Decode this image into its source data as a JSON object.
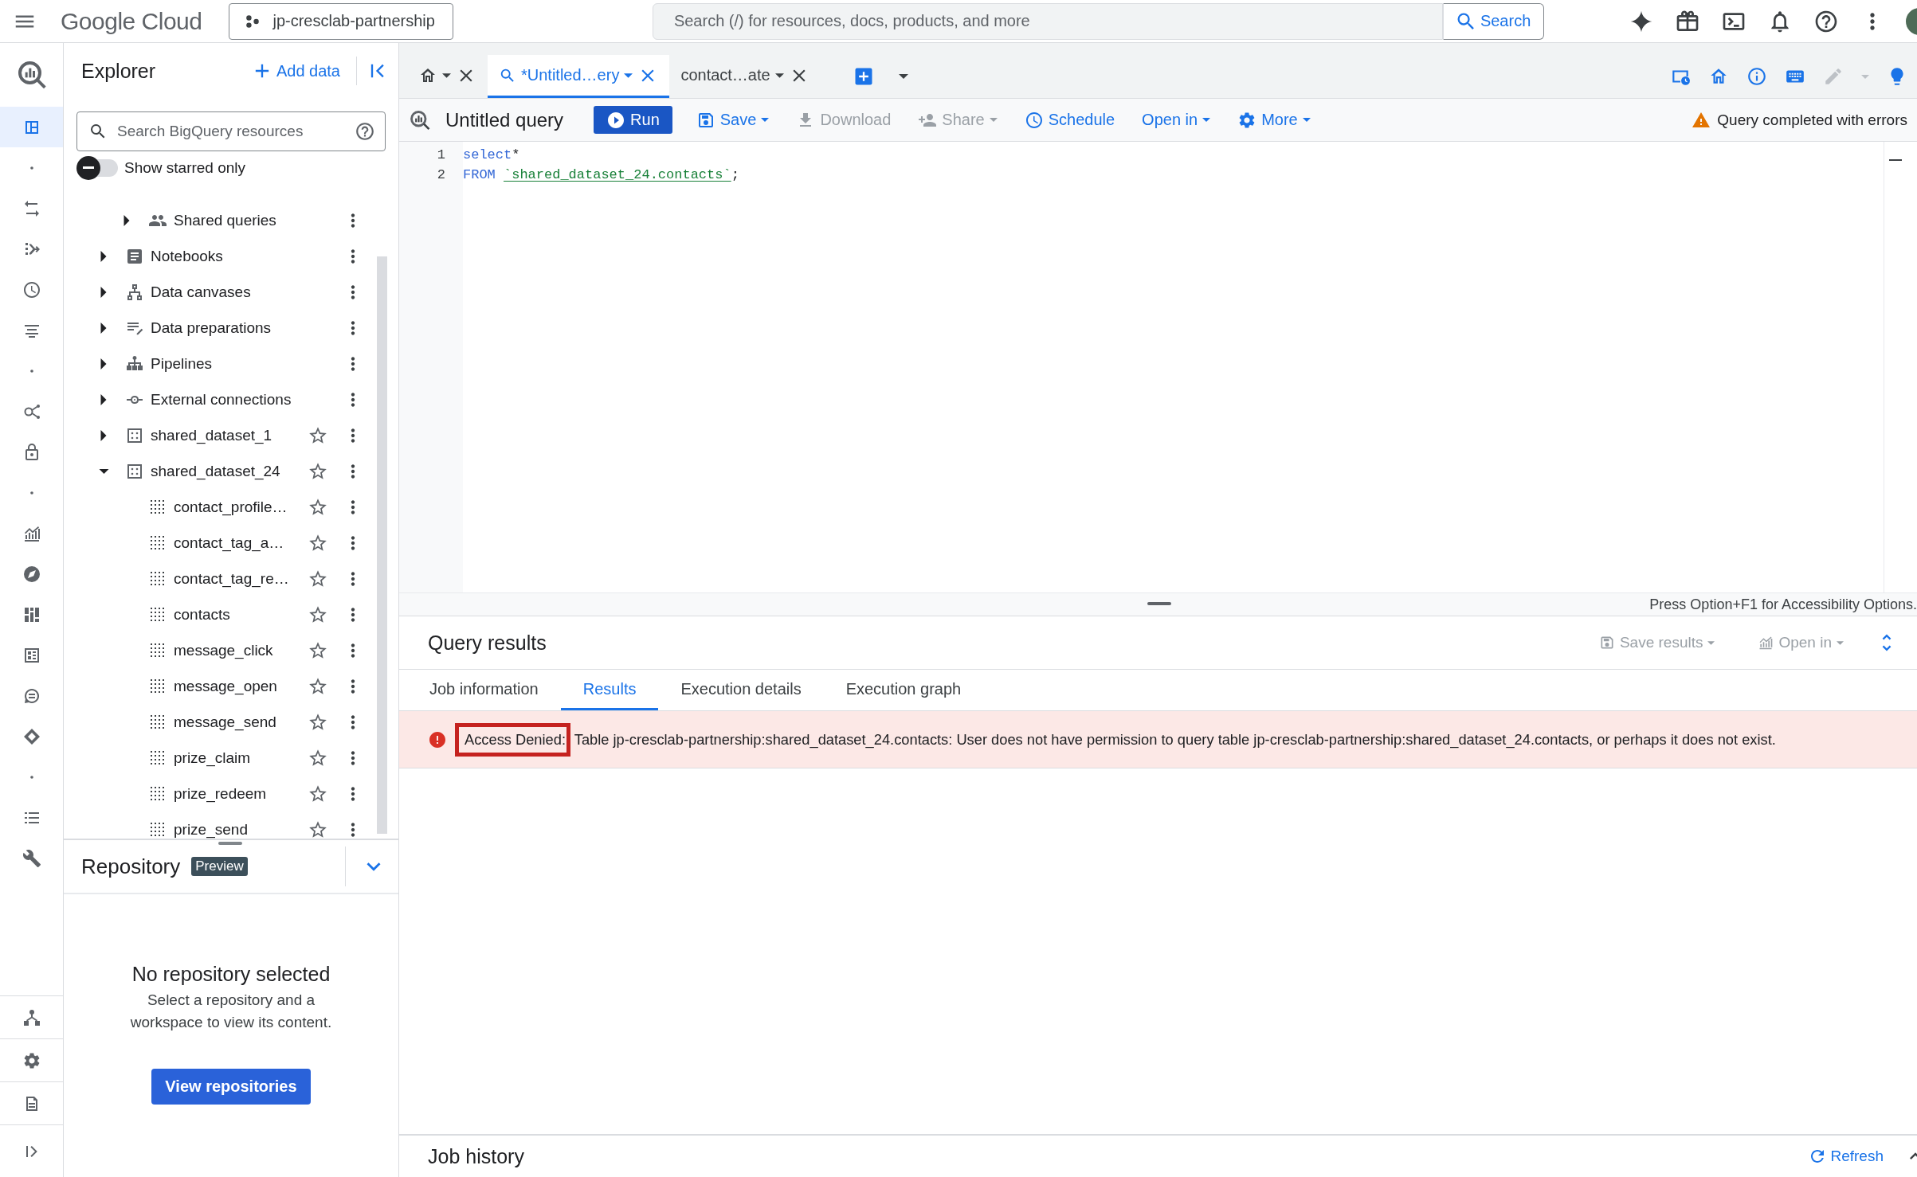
{
  "top_bar": {
    "product": "Google Cloud",
    "project": "jp-cresclab-partnership",
    "search": {
      "placeholder": "Search (/) for resources, docs, products, and more"
    },
    "search_button": "Search"
  },
  "rail": {
    "items": [
      {
        "kind": "explorer",
        "selected": true
      },
      {
        "kind": "dot",
        "selected": false
      },
      {
        "kind": "transfer",
        "selected": false
      },
      {
        "kind": "branch",
        "selected": false
      },
      {
        "kind": "clock",
        "selected": false
      },
      {
        "kind": "lines",
        "selected": false
      },
      {
        "kind": "dot",
        "selected": false
      },
      {
        "kind": "analytics",
        "selected": false
      },
      {
        "kind": "lock",
        "selected": false
      },
      {
        "kind": "dot",
        "selected": false
      },
      {
        "kind": "chart",
        "selected": false
      },
      {
        "kind": "compass",
        "selected": false
      },
      {
        "kind": "grid",
        "selected": false
      },
      {
        "kind": "table",
        "selected": false
      },
      {
        "kind": "chat",
        "selected": false
      },
      {
        "kind": "diamond",
        "selected": false
      },
      {
        "kind": "dot",
        "selected": false
      },
      {
        "kind": "list",
        "selected": false
      },
      {
        "kind": "wrench",
        "selected": false
      }
    ],
    "bottom": [
      {
        "kind": "hierarchy",
        "selected": false
      },
      {
        "kind": "settings",
        "selected": false
      },
      {
        "kind": "document",
        "selected": false
      },
      {
        "kind": "expand",
        "selected": false
      }
    ]
  },
  "explorer": {
    "title": "Explorer",
    "add_data": "Add data",
    "search": {
      "placeholder": "Search BigQuery resources"
    },
    "starred_toggle": {
      "label": "Show starred only",
      "on": false
    },
    "tree": [
      {
        "children": [
          {
            "label": "Shared queries",
            "kind": "people",
            "expanded": false
          }
        ]
      },
      {
        "label": "Notebooks",
        "kind": "notebook",
        "expanded": false
      },
      {
        "label": "Data canvases",
        "kind": "canvas",
        "expanded": false
      },
      {
        "label": "Data preparations",
        "kind": "preparation",
        "expanded": false
      },
      {
        "label": "Pipelines",
        "kind": "pipeline",
        "expanded": false
      },
      {
        "label": "External connections",
        "kind": "connection",
        "expanded": false
      },
      {
        "label": "shared_dataset_1",
        "kind": "dataset",
        "expanded": false,
        "starred": false
      },
      {
        "label": "shared_dataset_24",
        "kind": "dataset",
        "expanded": true,
        "starred": false,
        "children": [
          {
            "label": "contact_profile…",
            "kind": "table",
            "starred": false
          },
          {
            "label": "contact_tag_a…",
            "kind": "table",
            "starred": false
          },
          {
            "label": "contact_tag_re…",
            "kind": "table",
            "starred": false
          },
          {
            "label": "contacts",
            "kind": "table",
            "starred": false
          },
          {
            "label": "message_click",
            "kind": "table",
            "starred": false
          },
          {
            "label": "message_open",
            "kind": "table",
            "starred": false
          },
          {
            "label": "message_send",
            "kind": "table",
            "starred": false
          },
          {
            "label": "prize_claim",
            "kind": "table",
            "starred": false
          },
          {
            "label": "prize_redeem",
            "kind": "table",
            "starred": false
          },
          {
            "label": "prize_send",
            "kind": "table",
            "starred": false
          }
        ]
      }
    ],
    "repository": {
      "title": "Repository",
      "badge": "Preview",
      "empty_title": "No repository selected",
      "empty_text": "Select a repository and a workspace to view its content.",
      "button": "View repositories"
    }
  },
  "editor_tabs": [
    {
      "kind": "home",
      "selected": false
    },
    {
      "kind": "query",
      "label": "*Untitled…ery",
      "selected": true
    },
    {
      "kind": "table",
      "label": "contact…ate",
      "selected": false
    }
  ],
  "toolbar": {
    "title": "Untitled query",
    "buttons": [
      {
        "kind": "run",
        "label": "Run",
        "disabled": false,
        "dropdown": false
      },
      {
        "kind": "save",
        "label": "Save",
        "disabled": false,
        "dropdown": true
      },
      {
        "kind": "download",
        "label": "Download",
        "disabled": true,
        "dropdown": false
      },
      {
        "kind": "share",
        "label": "Share",
        "disabled": true,
        "dropdown": true
      },
      {
        "kind": "schedule",
        "label": "Schedule",
        "disabled": false,
        "dropdown": false
      },
      {
        "kind": "open",
        "label": "Open in",
        "disabled": false,
        "dropdown": true
      },
      {
        "kind": "more",
        "label": "More",
        "disabled": false,
        "dropdown": true
      }
    ],
    "status": "Query completed with errors"
  },
  "editor": {
    "lines": [
      {
        "number": "1",
        "tokens": [
          {
            "kind": "keyword",
            "text": "select"
          },
          {
            "kind": "plain",
            "text": "*"
          }
        ]
      },
      {
        "number": "2",
        "tokens": [
          {
            "kind": "keyword",
            "text": "FROM"
          },
          {
            "kind": "identifier",
            "text": "`shared_dataset_24.contacts`"
          },
          {
            "kind": "plain",
            "text": ";"
          }
        ]
      }
    ],
    "accessibility_hint": "Press Option+F1 for Accessibility Options."
  },
  "results": {
    "title": "Query results",
    "actions": [
      {
        "kind": "save",
        "label": "Save results",
        "disabled": true
      },
      {
        "kind": "open",
        "label": "Open in",
        "disabled": true
      }
    ],
    "tabs": [
      {
        "label": "Job information",
        "selected": false
      },
      {
        "label": "Results",
        "selected": true
      },
      {
        "label": "Execution details",
        "selected": false
      },
      {
        "label": "Execution graph",
        "selected": false
      }
    ],
    "error": {
      "prefix": "Access Denied:",
      "highlighted": true,
      "message": "Table jp-cresclab-partnership:shared_dataset_24.contacts: User does not have permission to query table jp-cresclab-partnership:shared_dataset_24.contacts, or perhaps it does not exist."
    }
  },
  "job_history": {
    "title": "Job history",
    "refresh": "Refresh"
  }
}
